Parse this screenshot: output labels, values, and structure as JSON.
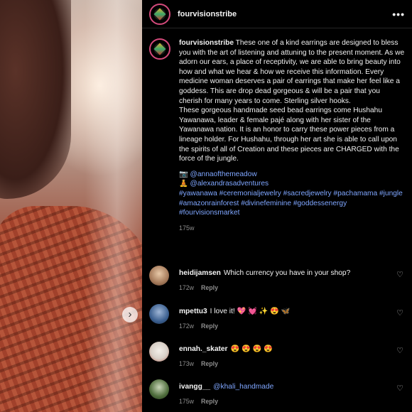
{
  "post": {
    "username": "fourvisionstribe",
    "more_label": "•••",
    "carousel_arrow": "›"
  },
  "caption": {
    "username": "fourvisionstribe",
    "para1": "These one of a kind earrings are designed to bless you with the art of listening and attuning to the present moment. As we adorn our ears, a place of receptivity, we are able to bring beauty into how and what we hear & how we receive this information. Every medicine woman deserves a pair of earrings that make her feel like a goddess. This are drop dead gorgeous & will be a pair that you cherish for many years to come. Sterling silver hooks.",
    "para2": "These gorgeous handmade seed bead earrings come Hushahu Yawanawa, leader & female pajé along with her sister of the Yawanawa nation. It is an honor to carry these power pieces from a lineage holder. For Hushahu, through her art she is able to call upon the spirits of all of Creation and these pieces are CHARGED with the force of the jungle.",
    "mention1_emoji": "📷",
    "mention1": "@annaofthemeadow",
    "mention2_emoji": "🧘",
    "mention2": "@alexandrasadventures",
    "hashtags": "#yawanawa #ceremonialjewelry #sacredjewelry #pachamama #jungle #amazonrainforest #divinefeminine #goddessenergy #fourvisionsmarket",
    "time": "175w"
  },
  "comments": [
    {
      "user": "heidijamsen",
      "text": "Which currency you have in your shop?",
      "time": "172w",
      "reply": "Reply",
      "avatar_color": "#c9a27e"
    },
    {
      "user": "mpettu3",
      "text": "I love it! 💖 💓 ✨ 😍 🦋",
      "time": "172w",
      "reply": "Reply",
      "avatar_color": "#3b5f8f"
    },
    {
      "user": "ennah._skater",
      "text": "😍 😍 😍 😍",
      "time": "173w",
      "reply": "Reply",
      "avatar_color": "#d8d0c8"
    },
    {
      "user": "ivangg__",
      "text": "@khali_handmade",
      "time": "175w",
      "reply": "Reply",
      "avatar_color": "#4d6b3a"
    }
  ],
  "icons": {
    "heart": "♡"
  }
}
